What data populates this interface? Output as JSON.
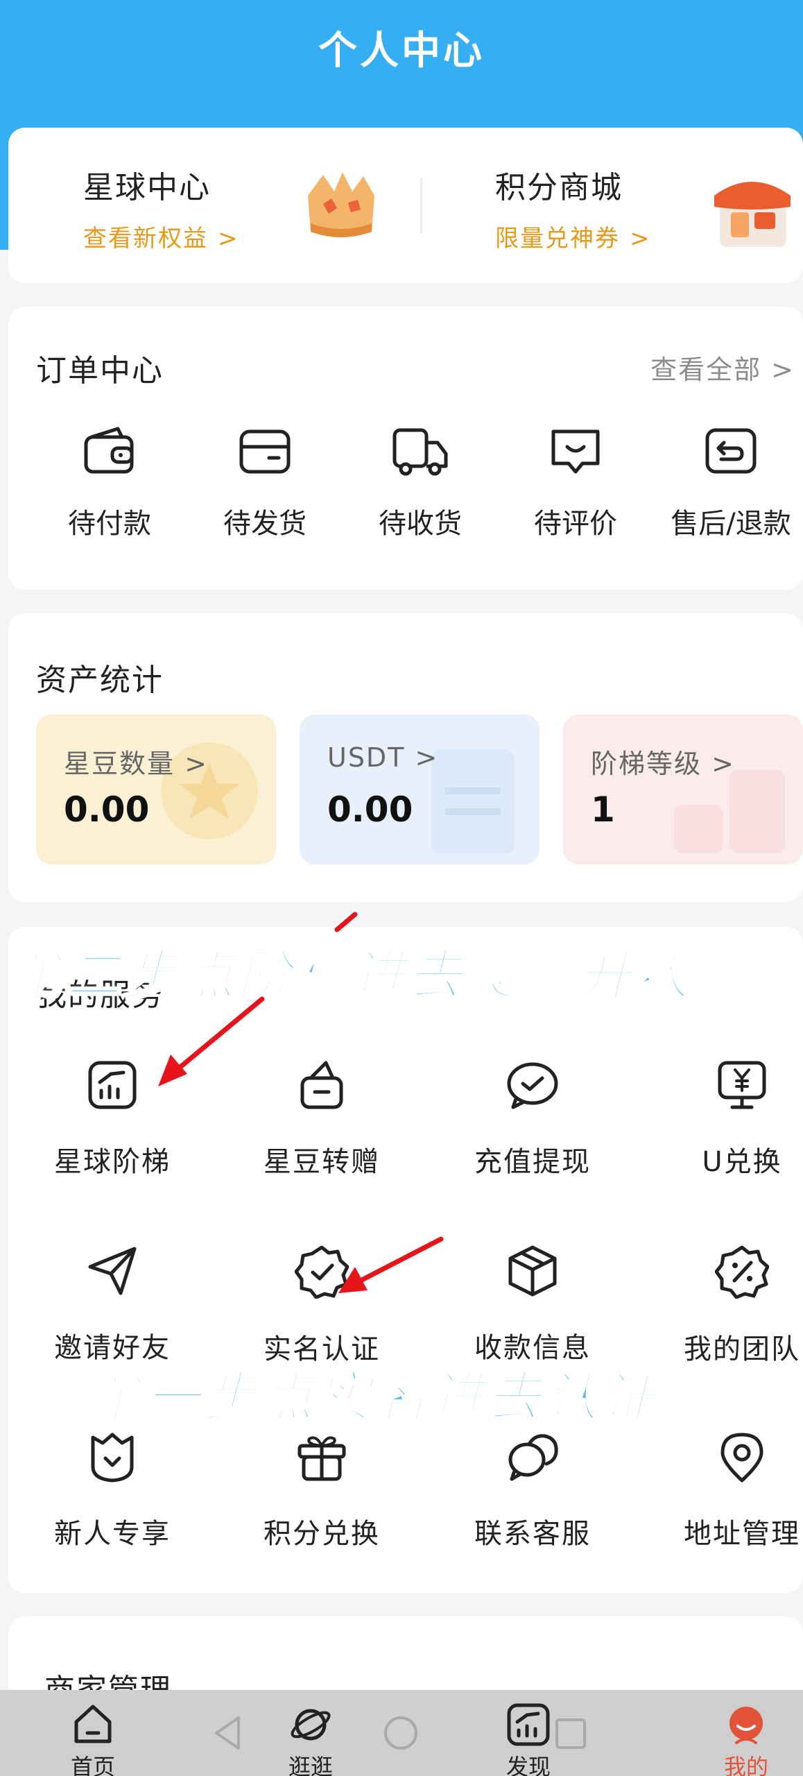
{
  "header": {
    "title": "个人中心"
  },
  "promo": {
    "left": {
      "title": "星球中心",
      "subtitle": "查看新权益",
      "chevron": ">"
    },
    "right": {
      "title": "积分商城",
      "subtitle": "限量兑神券",
      "chevron": ">"
    }
  },
  "orders": {
    "title": "订单中心",
    "view_all": "查看全部 >",
    "items": [
      {
        "label": "待付款",
        "icon": "wallet-icon"
      },
      {
        "label": "待发货",
        "icon": "box-icon"
      },
      {
        "label": "待收货",
        "icon": "truck-icon"
      },
      {
        "label": "待评价",
        "icon": "comment-icon"
      },
      {
        "label": "售后/退款",
        "icon": "return-icon"
      }
    ]
  },
  "assets": {
    "title": "资产统计",
    "tiles": [
      {
        "label": "星豆数量",
        "chevron": ">",
        "value": "0.00",
        "color": "#fbf0d4"
      },
      {
        "label": "USDT",
        "chevron": ">",
        "value": "0.00",
        "color": "#e8f0fb"
      },
      {
        "label": "阶梯等级",
        "chevron": ">",
        "value": "1",
        "color": "#fcebeb"
      }
    ]
  },
  "services": {
    "title": "我的服务",
    "items": [
      {
        "label": "星球阶梯",
        "icon": "chart-icon"
      },
      {
        "label": "星豆转赠",
        "icon": "gift-bag-icon"
      },
      {
        "label": "充值提现",
        "icon": "check-chat-icon"
      },
      {
        "label": "U兑换",
        "icon": "yen-monitor-icon"
      },
      {
        "label": "邀请好友",
        "icon": "send-icon"
      },
      {
        "label": "实名认证",
        "icon": "verified-badge-icon"
      },
      {
        "label": "收款信息",
        "icon": "package-icon"
      },
      {
        "label": "我的团队",
        "icon": "discount-badge-icon"
      },
      {
        "label": "新人专享",
        "icon": "shield-heart-icon"
      },
      {
        "label": "积分兑换",
        "icon": "gift-box-icon"
      },
      {
        "label": "联系客服",
        "icon": "chat-bubbles-icon"
      },
      {
        "label": "地址管理",
        "icon": "location-icon"
      }
    ]
  },
  "merchant": {
    "title": "商家管理"
  },
  "annotations": {
    "step2": "第二步点阶梯进去爬墙升级",
    "step1": "第一步点实名进去认证"
  },
  "nav": {
    "items": [
      {
        "label": "首页",
        "icon": "home-icon"
      },
      {
        "label": "逛逛",
        "icon": "planet-icon"
      },
      {
        "label": "发现",
        "icon": "trend-icon"
      },
      {
        "label": "我的",
        "icon": "profile-icon"
      }
    ]
  },
  "colors": {
    "brand": "#35aef3",
    "accent": "#e69a1c",
    "active": "#e2543a",
    "annotation": "#5ab8f2"
  }
}
